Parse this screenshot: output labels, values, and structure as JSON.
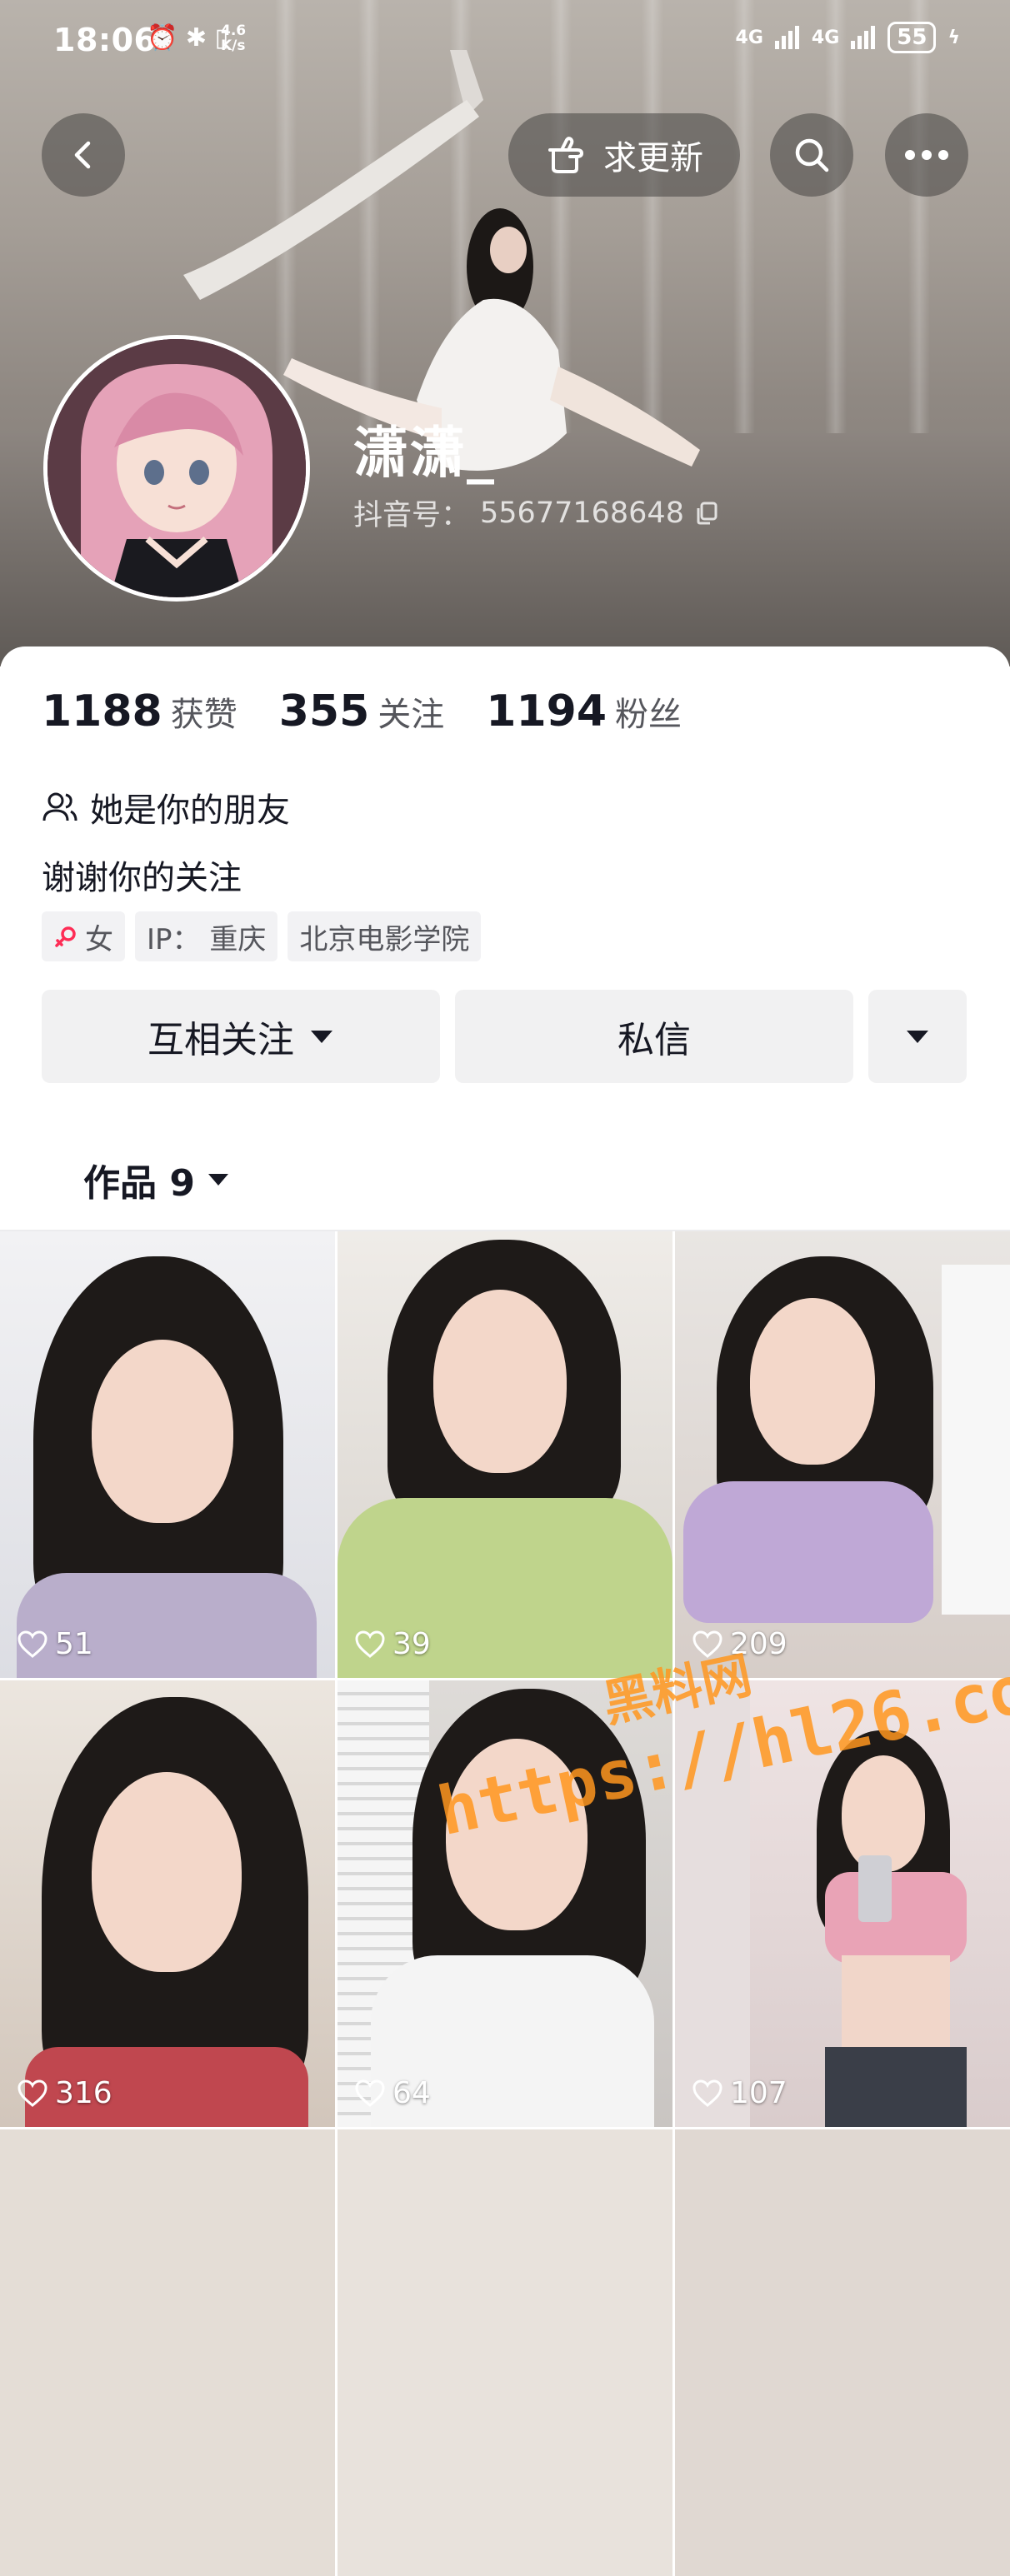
{
  "status_bar": {
    "time": "18:06",
    "net_speed_value": "4.6",
    "net_speed_unit": "K/s",
    "net_type_1": "4G",
    "net_type_2": "4G",
    "battery": "55"
  },
  "header": {
    "update_request_label": "求更新",
    "username": "潇潇_",
    "douyin_id_label": "抖音号：",
    "douyin_id": "55677168648"
  },
  "stats": [
    {
      "value": "1188",
      "label": "获赞"
    },
    {
      "value": "355",
      "label": "关注"
    },
    {
      "value": "1194",
      "label": "粉丝"
    }
  ],
  "friend_relation": "她是你的朋友",
  "bio": "谢谢你的关注",
  "tags": {
    "gender": "女",
    "ip": "IP：  重庆",
    "school": "北京电影学院"
  },
  "actions": {
    "follow_label": "互相关注",
    "message_label": "私信"
  },
  "works": {
    "tab_label": "作品 9",
    "items": [
      {
        "likes": "51"
      },
      {
        "likes": "39"
      },
      {
        "likes": "209"
      },
      {
        "likes": "316"
      },
      {
        "likes": "64"
      },
      {
        "likes": "107"
      }
    ]
  },
  "watermark": {
    "line1": "黑料网",
    "line2": "https://hl26.co"
  },
  "colors": {
    "text_primary": "#161823",
    "text_secondary": "#55565c",
    "button_bg": "#f1f1f2",
    "gender_icon": "#fe2c55",
    "watermark": "#ff961e"
  },
  "icons": [
    "back-icon",
    "hand-point-icon",
    "search-icon",
    "more-icon",
    "copy-icon",
    "friends-icon",
    "female-icon",
    "caret-down-icon",
    "heart-icon"
  ]
}
